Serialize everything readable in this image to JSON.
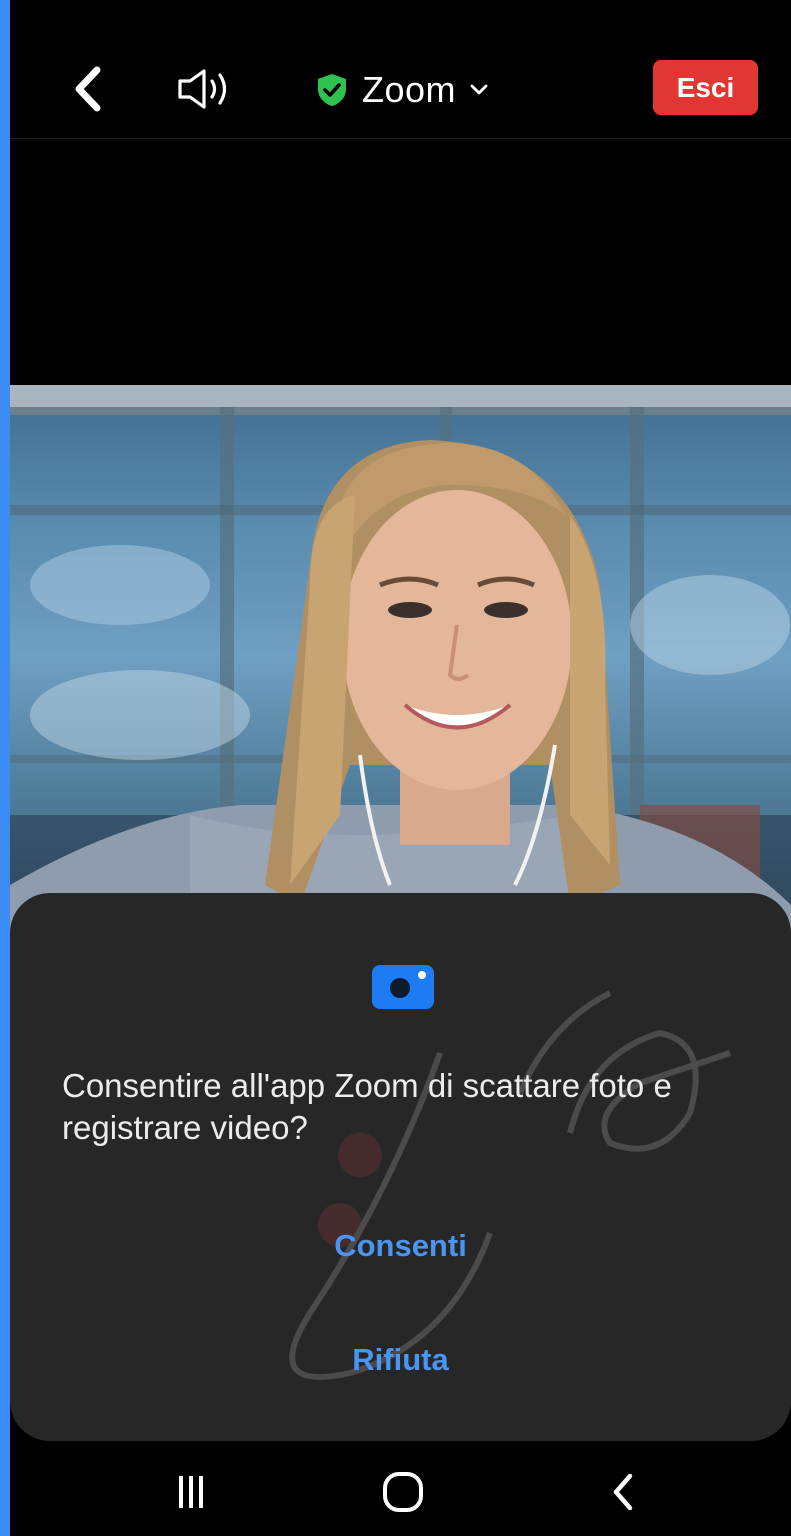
{
  "header": {
    "back_icon": "chevron-left-icon",
    "speaker_icon": "speaker-icon",
    "security_icon": "shield-check-icon",
    "security_color": "#2fc250",
    "title": "Zoom",
    "dropdown_icon": "chevron-down-icon",
    "leave_label": "Esci",
    "leave_color": "#e23634"
  },
  "dialog": {
    "icon": "camera-icon",
    "icon_color": "#1e7cf2",
    "question": "Consentire all'app Zoom di scattare foto e registrare video?",
    "allow_label": "Consenti",
    "deny_label": "Rifiuta",
    "action_color": "#4a94f2"
  },
  "navbar": {
    "recents_icon": "recent-apps-icon",
    "home_icon": "home-icon",
    "back_icon": "back-icon"
  }
}
